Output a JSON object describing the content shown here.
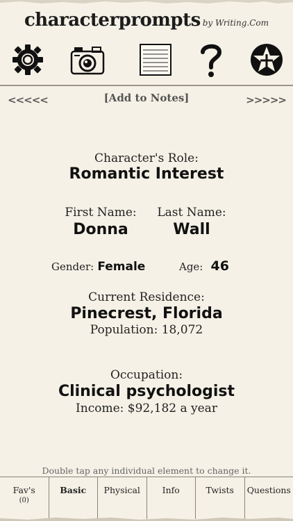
{
  "header": {
    "logo_main": "characterprompts",
    "logo_by": "by Writing.Com",
    "icons": [
      "settings-gear-icon",
      "camera-icon",
      "notes-icon",
      "help-question-icon",
      "add-favorite-star-icon"
    ]
  },
  "nav": {
    "prev_label": "<<<<<",
    "add_notes_label": "[Add to Notes]",
    "next_label": ">>>>>"
  },
  "character": {
    "role_label": "Character's Role:",
    "role_value": "Romantic Interest",
    "first_name_label": "First Name:",
    "first_name_value": "Donna",
    "last_name_label": "Last Name:",
    "last_name_value": "Wall",
    "gender_label": "Gender:",
    "gender_value": "Female",
    "age_label": "Age:",
    "age_value": "46",
    "residence_label": "Current Residence:",
    "residence_value": "Pinecrest, Florida",
    "population_text": "Population: 18,072",
    "occupation_label": "Occupation:",
    "occupation_value": "Clinical psychologist",
    "income_text": "Income: $92,182 a year"
  },
  "hint": "Double tap any individual element to change it.",
  "tabs": [
    {
      "label": "Fav's",
      "sub": "(0)",
      "active": false
    },
    {
      "label": "Basic",
      "active": true
    },
    {
      "label": "Physical",
      "active": false
    },
    {
      "label": "Info",
      "active": false
    },
    {
      "label": "Twists",
      "active": false
    },
    {
      "label": "Questions",
      "active": false
    }
  ],
  "colors": {
    "paper": "#f5f1e6",
    "ink": "#222222",
    "rule": "#9a948a"
  }
}
